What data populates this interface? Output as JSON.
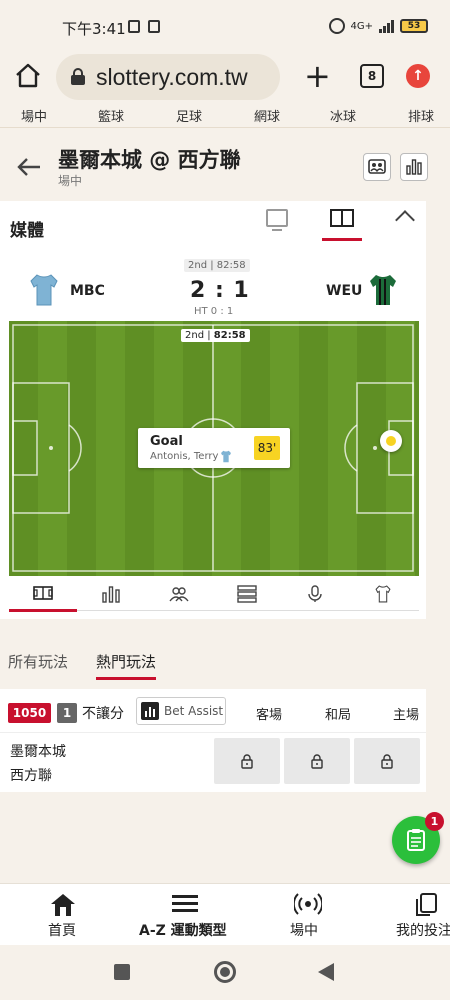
{
  "status_bar": {
    "time": "下午3:41",
    "network": "4G+",
    "battery": "53"
  },
  "browser": {
    "url": "slottery.com.tw",
    "tab_count": "8"
  },
  "sport_nav": [
    "場中",
    "籃球",
    "足球",
    "網球",
    "冰球",
    "排球"
  ],
  "match": {
    "title": "墨爾本城 @ 西方聯",
    "status": "場中"
  },
  "media": {
    "label": "媒體",
    "period": "2nd | 82:58",
    "clock_period": "2nd",
    "clock_time": "82:58",
    "home_abbr": "MBC",
    "away_abbr": "WEU",
    "score": "2 : 1",
    "halftime": "HT 0 : 1",
    "event": {
      "type": "Goal",
      "player": "Antonis, Terry",
      "minute": "83'"
    },
    "view_tabs": [
      "pitch-view-icon",
      "stats-bars-icon",
      "lineups-icon",
      "list-rows-icon",
      "microphone-icon",
      "jersey-icon"
    ]
  },
  "bet_tabs": [
    "所有玩法",
    "熱門玩法"
  ],
  "market": {
    "code": "1050",
    "number": "1",
    "name": "不讓分",
    "assist": "Bet Assist",
    "columns": [
      "客場",
      "和局",
      "主場"
    ],
    "team_home": "墨爾本城",
    "team_away": "西方聯"
  },
  "fab_badge": "1",
  "bottom_nav": [
    "首頁",
    "A-Z 運動類型",
    "場中",
    "我的投注"
  ],
  "colors": {
    "accent": "#c8102e",
    "pitch": "#5f8f24",
    "fab": "#2bbf3b",
    "highlight": "#f7d323"
  }
}
